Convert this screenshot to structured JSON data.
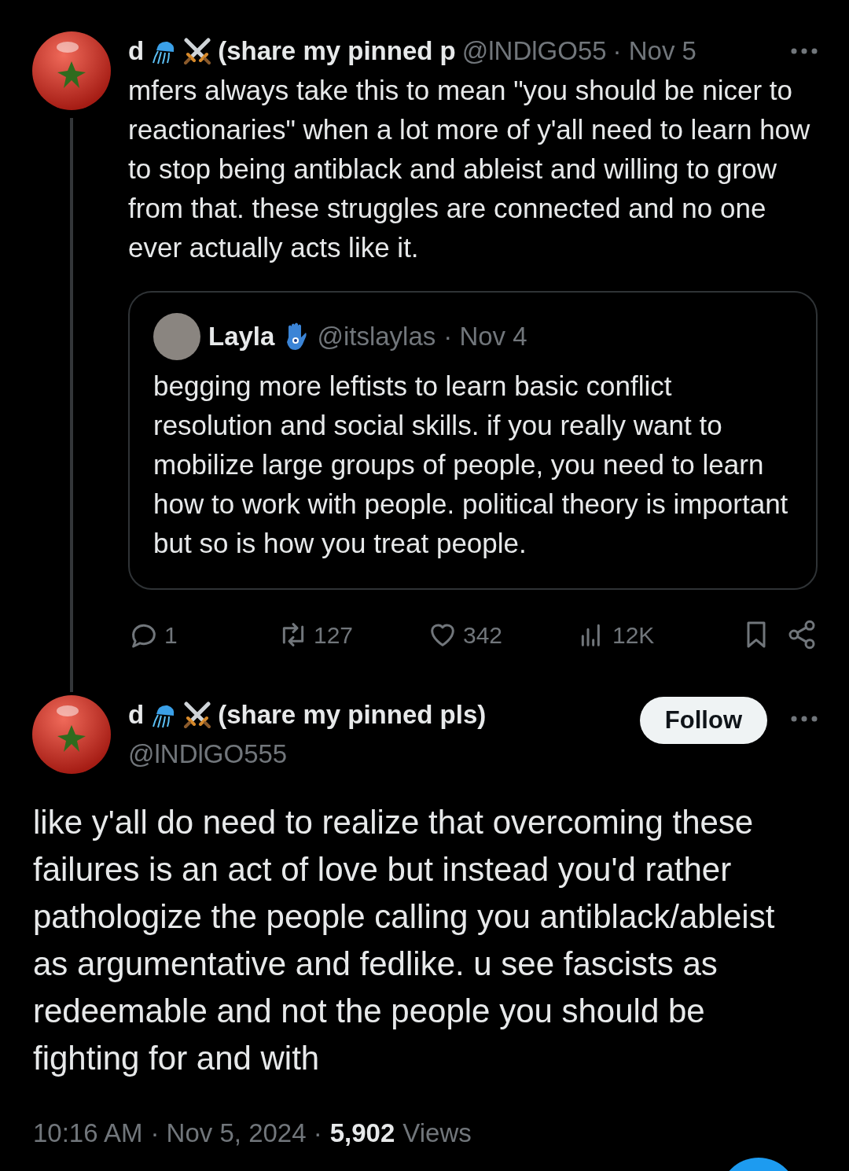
{
  "thread_tweet": {
    "author": {
      "name": "d",
      "name_suffix": "(share my pinned p",
      "handle": "@lNDlGO55"
    },
    "date": "· Nov 5",
    "text": "mfers always take this to mean \"you should be nicer to reactionaries\" when a lot more of y'all need to learn how to stop being antiblack and ableist and willing to grow from that. these struggles are connected and no one ever actually acts like it.",
    "quote": {
      "author": {
        "name": "Layla",
        "handle": "@itslaylas"
      },
      "date": "· Nov 4",
      "text": "begging more leftists to learn basic conflict resolution and social skills. if you really want to mobilize large groups of people, you need to learn how to work with people. political theory is important but so is how you treat people."
    },
    "actions": [
      {
        "kind": "reply",
        "count": "1"
      },
      {
        "kind": "repost",
        "count": "127"
      },
      {
        "kind": "like",
        "count": "342"
      },
      {
        "kind": "views",
        "count": "12K"
      },
      {
        "kind": "bookmark"
      },
      {
        "kind": "share"
      }
    ]
  },
  "main_tweet": {
    "author": {
      "name": "d",
      "name_suffix": "(share my pinned pls)",
      "handle": "@lNDlGO555"
    },
    "follow_button": "Follow",
    "text": "like y'all do need to realize that overcoming these failures is an act of love but instead you'd rather pathologize the people calling you antiblack/ableist as argumentative and fedlike. u see fascists as redeemable and not the people you should be fighting for and with",
    "time": "10:16 AM",
    "date": "· Nov 5, 2024 ·",
    "views_count": "5,902",
    "views_label": "Views"
  }
}
